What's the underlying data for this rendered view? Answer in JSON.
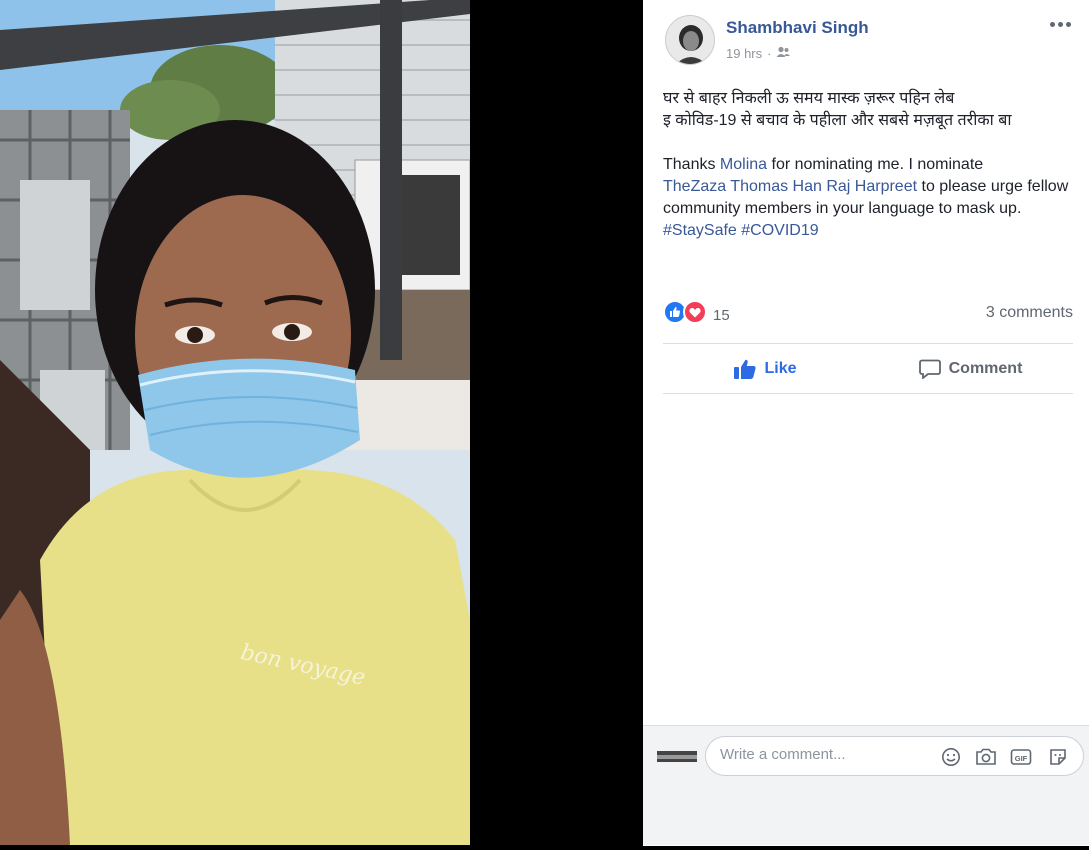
{
  "post": {
    "author": "Shambhavi Singh",
    "time": "19 hrs",
    "audience_icon": "friends-icon",
    "body": {
      "line1": "घर से बाहर निकली ऊ समय मास्क ज़रूर पहिन लेब",
      "line2": "इ कोविड-19 से बचाव के पहीला और सबसे मज़बूत तरीका बा",
      "thanks_prefix": "Thanks ",
      "nominator": "Molina",
      "thanks_mid": " for nominating me. I nominate",
      "nominees": "TheZaza Thomas Han Raj Harpreet",
      "thanks_suffix": " to please urge fellow community members in your language to mask up. ",
      "hashtag1": "#StaySafe",
      "hashtag2": "#COVID19"
    },
    "reaction_count": "15",
    "comments_label": "3 comments"
  },
  "actions": {
    "like_label": "Like",
    "comment_label": "Comment"
  },
  "comment_composer": {
    "placeholder": "Write a comment...",
    "icons": [
      "emoji-icon",
      "camera-icon",
      "gif-icon",
      "sticker-icon"
    ]
  },
  "colors": {
    "link": "#385898",
    "like_blue": "#2078f4",
    "love_red": "#f33e58",
    "muted": "#606770"
  }
}
